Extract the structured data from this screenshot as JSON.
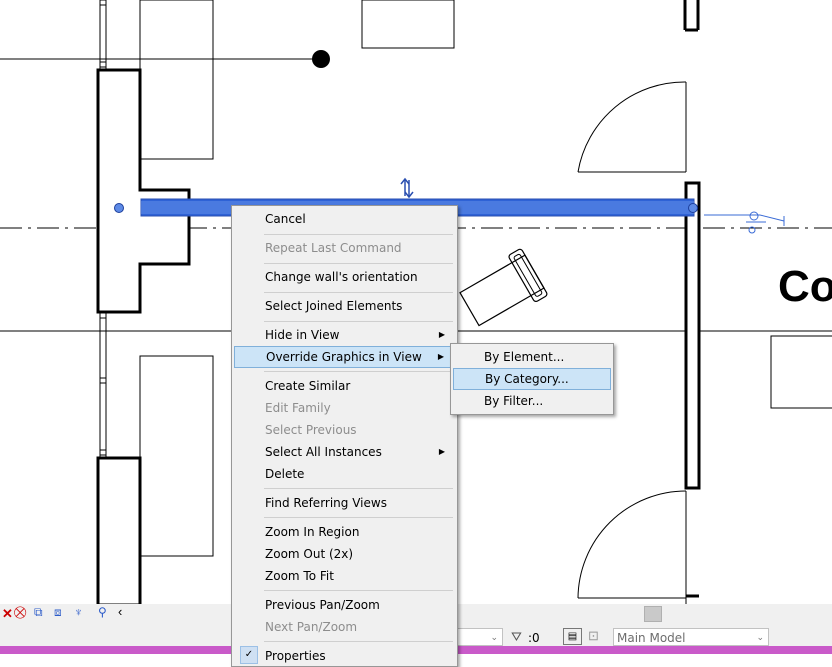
{
  "drawing": {
    "label_partial": "Co"
  },
  "context_menu": {
    "items": [
      {
        "label": "Cancel",
        "disabled": false
      },
      {
        "label": "Repeat Last Command",
        "disabled": true
      },
      {
        "label": "Change wall's orientation",
        "disabled": false
      },
      {
        "label": "Select Joined Elements",
        "disabled": false
      },
      {
        "label": "Hide in View",
        "disabled": false,
        "submenu": true
      },
      {
        "label": "Override Graphics in View",
        "disabled": false,
        "submenu": true,
        "highlighted": true
      },
      {
        "label": "Create Similar",
        "disabled": false
      },
      {
        "label": "Edit Family",
        "disabled": true
      },
      {
        "label": "Select Previous",
        "disabled": true
      },
      {
        "label": "Select All Instances",
        "disabled": false,
        "submenu": true
      },
      {
        "label": "Delete",
        "disabled": false
      },
      {
        "label": "Find Referring Views",
        "disabled": false
      },
      {
        "label": "Zoom In Region",
        "disabled": false
      },
      {
        "label": "Zoom Out (2x)",
        "disabled": false
      },
      {
        "label": "Zoom To Fit",
        "disabled": false
      },
      {
        "label": "Previous Pan/Zoom",
        "disabled": false
      },
      {
        "label": "Next Pan/Zoom",
        "disabled": true
      },
      {
        "label": "Properties",
        "disabled": false
      }
    ]
  },
  "submenu": {
    "items": [
      {
        "label": "By Element..."
      },
      {
        "label": "By Category...",
        "highlighted": true
      },
      {
        "label": "By Filter..."
      }
    ]
  },
  "statusbar": {
    "selection_count": ":0",
    "model_name": "Main Model"
  },
  "colors": {
    "selection_blue": "#2e62d6",
    "menu_bg": "#f0f0f0",
    "highlight": "#cce4f7",
    "highlight_border": "#80b0da",
    "status_pink": "#c95ac9"
  }
}
